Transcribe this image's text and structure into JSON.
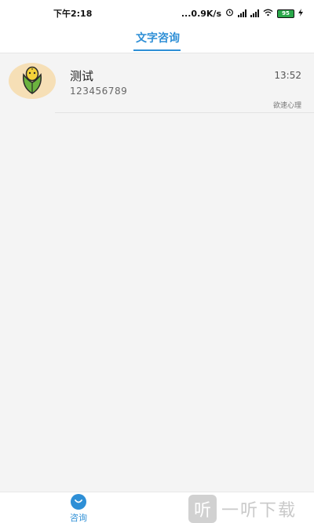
{
  "status_bar": {
    "time": "下午2:18",
    "network_speed": "...0.9K/s",
    "battery": "95",
    "icons": [
      "alarm-icon",
      "signal-icon",
      "signal-icon",
      "wifi-icon",
      "battery-icon",
      "charging-icon"
    ]
  },
  "header": {
    "tab_label": "文字咨询"
  },
  "conversation": {
    "name": "测试",
    "time": "13:52",
    "preview": "123456789",
    "source": "欲速心理",
    "avatar_icon": "corn-icon"
  },
  "bottom_nav": {
    "items": [
      {
        "label": "咨询",
        "icon": "chat-bubble-icon",
        "active": true
      }
    ]
  },
  "watermark": {
    "logo_char": "听",
    "text": "一听下载"
  },
  "colors": {
    "accent": "#2e8fd6",
    "avatar_bg": "#f6dfb6",
    "background": "#f4f4f4"
  }
}
